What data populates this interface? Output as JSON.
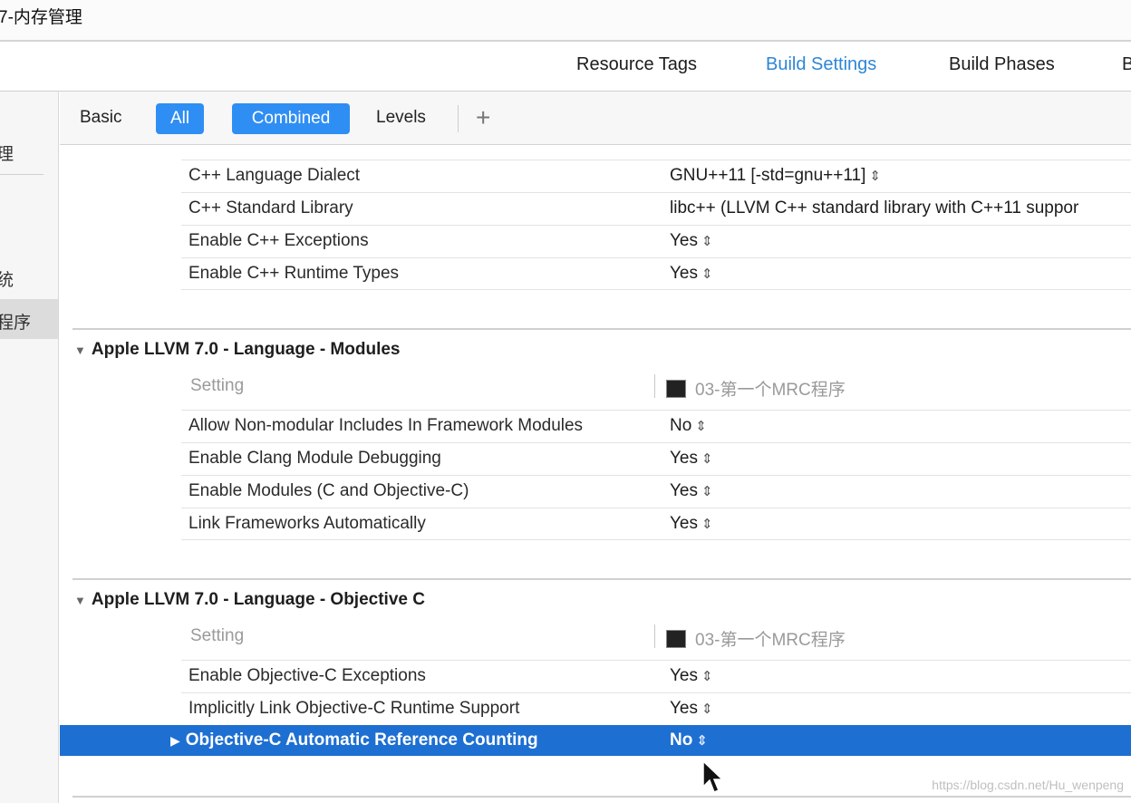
{
  "window": {
    "title": "7-内存管理"
  },
  "tabs": [
    "Resource Tags",
    "Build Settings",
    "Build Phases",
    "B"
  ],
  "sidebar": {
    "items": [
      "理",
      "统",
      "程序"
    ]
  },
  "filter": {
    "basic": "Basic",
    "all": "All",
    "combined": "Combined",
    "levels": "Levels",
    "add": "+"
  },
  "settings_top": [
    {
      "label": "C++ Language Dialect",
      "value": "GNU++11 [-std=gnu++11]",
      "stepper": "⇕"
    },
    {
      "label": "C++ Standard Library",
      "value": "libc++ (LLVM C++ standard library with C++11 suppor",
      "stepper": ""
    },
    {
      "label": "Enable C++ Exceptions",
      "value": "Yes",
      "stepper": "⇕"
    },
    {
      "label": "Enable C++ Runtime Types",
      "value": "Yes",
      "stepper": "⇕"
    }
  ],
  "section_modules": {
    "title": "Apple LLVM 7.0 - Language - Modules",
    "setting_header": "Setting",
    "target": "03-第一个MRC程序",
    "rows": [
      {
        "label": "Allow Non-modular Includes In Framework Modules",
        "value": "No",
        "stepper": "⇕"
      },
      {
        "label": "Enable Clang Module Debugging",
        "value": "Yes",
        "stepper": "⇕"
      },
      {
        "label": "Enable Modules (C and Objective-C)",
        "value": "Yes",
        "stepper": "⇕"
      },
      {
        "label": "Link Frameworks Automatically",
        "value": "Yes",
        "stepper": "⇕"
      }
    ]
  },
  "section_objc": {
    "title": "Apple LLVM 7.0 - Language - Objective C",
    "setting_header": "Setting",
    "target": "03-第一个MRC程序",
    "rows": [
      {
        "label": "Enable Objective-C Exceptions",
        "value": "Yes",
        "stepper": "⇕"
      },
      {
        "label": "Implicitly Link Objective-C Runtime Support",
        "value": "Yes",
        "stepper": "⇕"
      }
    ],
    "selected_row": {
      "label": "Objective-C Automatic Reference Counting",
      "value": "No",
      "stepper": "⇕"
    }
  },
  "icons": {
    "disclosure_open": "▼",
    "disclosure_closed": "▶",
    "cursor": "arrow-cursor-icon"
  },
  "colors": {
    "accent": "#2f8ef3",
    "selection": "#1e6fd2",
    "active_tab": "#2d86d6"
  },
  "watermark": "https://blog.csdn.net/Hu_wenpeng"
}
